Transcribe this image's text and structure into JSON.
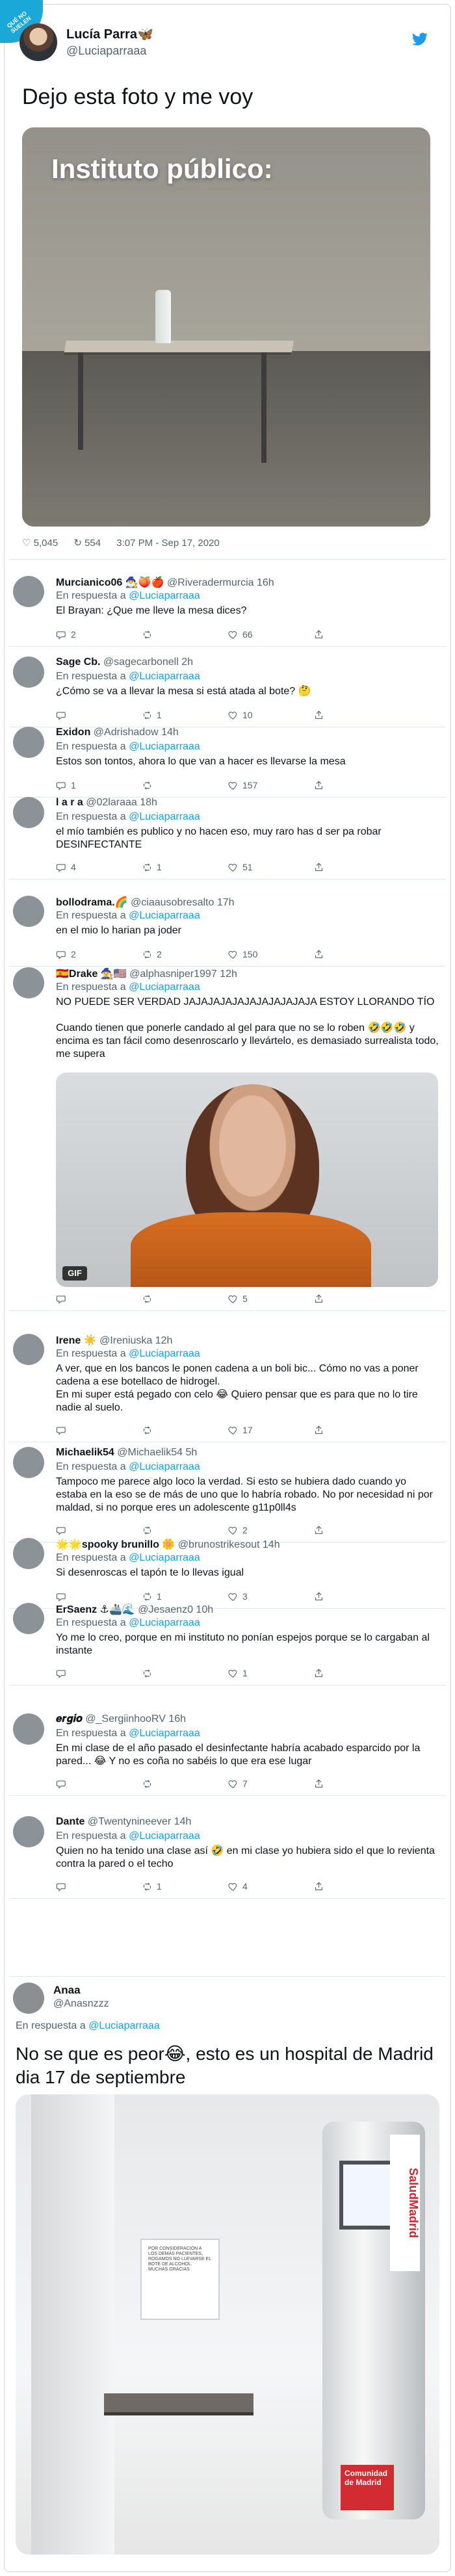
{
  "badge": "QUÉ NO SUELEN",
  "header": {
    "name": "Lucía Parra🦋",
    "handle": "@Luciaparraaa"
  },
  "main_tweet": {
    "text": "Dejo esta foto y me voy",
    "image_overlay": "Instituto público:",
    "likes": "5,045",
    "retweets": "554",
    "datetime": "3:07 PM - Sep 17, 2020"
  },
  "reply_label": "En respuesta a",
  "mention": "@Luciaparraaa",
  "replies": [
    {
      "name": "Murcianico06",
      "extra": "🧙‍♂️🍑🍎",
      "handle": "@Riveradermurcia",
      "time": "16h",
      "text": "El Brayan: ¿Que me lleve la mesa dices?",
      "comments": "2",
      "retweets": "",
      "likes": "66"
    },
    {
      "name": "Sage Cb.",
      "extra": "",
      "handle": "@sagecarbonell",
      "time": "2h",
      "text": "¿Cómo se va a llevar la mesa si está atada al bote? 🤔",
      "comments": "",
      "retweets": "1",
      "likes": "10"
    },
    {
      "name": "Exidon",
      "extra": "",
      "handle": "@Adrishadow",
      "time": "14h",
      "text": "Estos son tontos, ahora lo que van a hacer es llevarse la mesa",
      "comments": "1",
      "retweets": "",
      "likes": "157"
    },
    {
      "name": "l a r a",
      "extra": "",
      "handle": "@02laraaa",
      "time": "18h",
      "text": "el mío también es publico y no hacen eso, muy raro has d ser pa robar DESINFECTANTE",
      "comments": "4",
      "retweets": "1",
      "likes": "51"
    },
    {
      "name": "bollodrama.🌈",
      "extra": "",
      "handle": "@ciaausobresalto",
      "time": "17h",
      "text": "en el mio lo harian pa joder",
      "comments": "2",
      "retweets": "2",
      "likes": "150"
    },
    {
      "name": "🇪🇸Drake",
      "extra": "🧙🇺🇸",
      "handle": "@alphasniper1997",
      "time": "12h",
      "text": "NO PUEDE SER VERDAD JAJAJAJAJAJAJAJAJAJAJA ESTOY LLORANDO TÍO\n\nCuando tienen que ponerle candado al gel para que no se lo roben 🤣🤣🤣 y encima es tan fácil como desenroscarlo y llevártelo, es demasiado surrealista todo, me supera",
      "comments": "",
      "retweets": "",
      "likes": "5"
    },
    {
      "name": "Irene",
      "extra": "☀️",
      "handle": "@Ireniuska",
      "time": "12h",
      "text": "A ver, que en los bancos le ponen cadena a un boli bic... Cómo no vas a poner cadena a ese botellaco de hidrogel.\nEn mi super está pegado con celo 😂 Quiero pensar que es para que no lo tire nadie al suelo.",
      "comments": "",
      "retweets": "",
      "likes": "17"
    },
    {
      "name": "Michaelik54",
      "extra": "",
      "handle": "@Michaelik54",
      "time": "5h",
      "text": "Tampoco me parece algo loco la verdad. Si esto se hubiera dado cuando yo estaba en la eso se de más de uno que lo habría robado. No por necesidad ni por maldad, si no porque eres un adolescente g11p0ll4s",
      "comments": "",
      "retweets": "",
      "likes": "2"
    },
    {
      "name": "🌟🌟spooky brunillo",
      "extra": "🌼",
      "handle": "@brunostrikesout",
      "time": "14h",
      "text": "Si desenroscas el tapón te lo llevas igual",
      "comments": "",
      "retweets": "1",
      "likes": "3"
    },
    {
      "name": "ErSaenz",
      "extra": "⚓🚢🌊",
      "handle": "@Jesaenz0",
      "time": "10h",
      "text": "Yo me lo creo, porque en mi instituto no ponían espejos porque se lo cargaban al instante",
      "comments": "",
      "retweets": "",
      "likes": "1"
    },
    {
      "name": "𝒆𝒓𝒈𝒊𝒐",
      "extra": "",
      "handle": "@_SergiinhooRV",
      "time": "16h",
      "text": "En mi clase de el año pasado el desinfectante habría acabado esparcido por la pared... 😂 Y no es coña no sabéis lo que era ese lugar",
      "comments": "",
      "retweets": "",
      "likes": "7"
    },
    {
      "name": "Dante",
      "extra": "",
      "handle": "@Twentynineever",
      "time": "14h",
      "text": "Quien no ha tenido una clase así 🤣 en mi clase yo hubiera sido el que lo revienta contra la pared o el techo",
      "comments": "",
      "retweets": "1",
      "likes": "4"
    }
  ],
  "final_tweet": {
    "name": "Anaa",
    "handle": "@Anasnzzz",
    "text": "No se que es peor😂, esto es un hospital de Madrid dia 17 de septiembre",
    "sign_text": "POR CONSIDERACIÓN A LOS DEMÁS PACIENTES, ROGAMOS NO LLEVARSE EL BOTE DE ALCOHOL. MUCHAS GRACIAS",
    "brand": "SaludMadrid",
    "redmark": "Comunidad de Madrid"
  },
  "colors": {
    "accent": "#1d9bf0",
    "badge": "#19a8d8",
    "text": "#0f1419",
    "muted": "#536471"
  }
}
